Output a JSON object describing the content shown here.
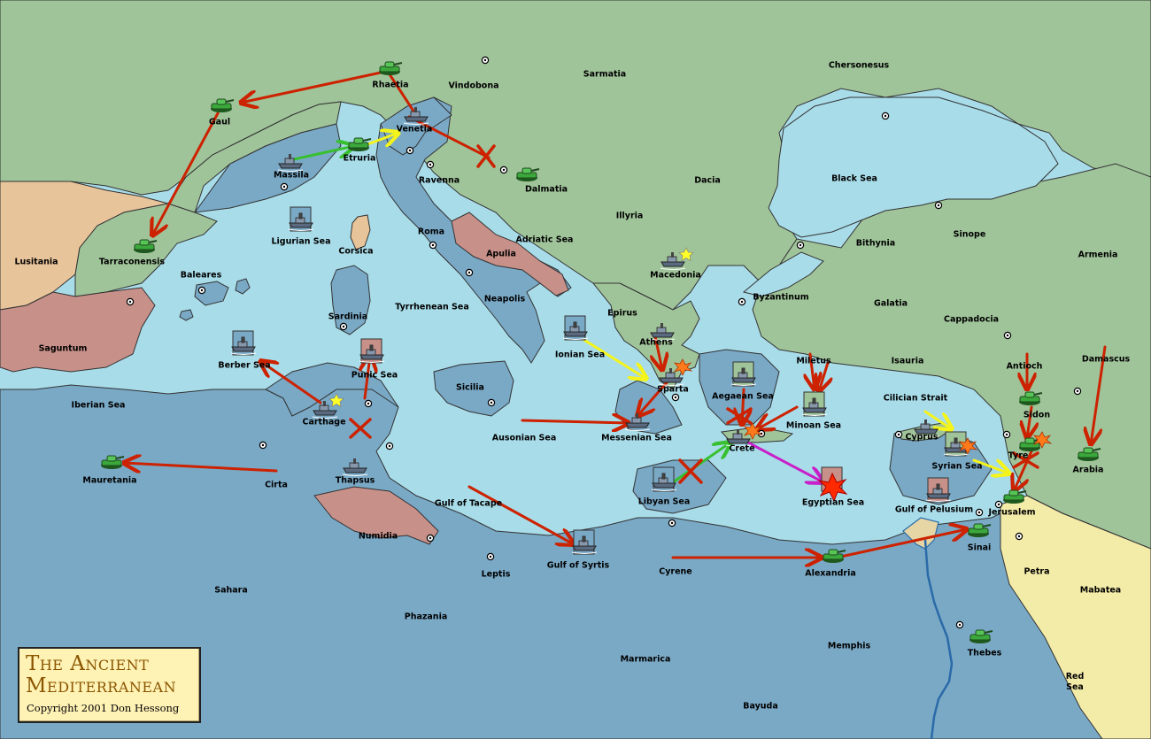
{
  "title": {
    "line1": "The Ancient",
    "line2": "Mediterranean",
    "copyright": "Copyright  2001  Don Hessong"
  },
  "colors": {
    "deep_sea": "#a8dce9",
    "sea_zone": "#7aa9c6",
    "land_green": "#a0c49a",
    "land_tan": "#e8c49a",
    "land_rose": "#c79089",
    "land_cream": "#f3eba8",
    "order_red": "#cc2200",
    "order_yellow": "#f4f41a",
    "order_green": "#38c030",
    "order_magenta": "#c820c8"
  },
  "territories": [
    {
      "name": "Sarmatia"
    },
    {
      "name": "Chersonesus"
    },
    {
      "name": "Vindobona"
    },
    {
      "name": "Rhaetia"
    },
    {
      "name": "Gaul"
    },
    {
      "name": "Venetia"
    },
    {
      "name": "Etruria"
    },
    {
      "name": "Massila"
    },
    {
      "name": "Ravenna"
    },
    {
      "name": "Dalmatia"
    },
    {
      "name": "Dacia"
    },
    {
      "name": "Black Sea"
    },
    {
      "name": "Illyria"
    },
    {
      "name": "Roma"
    },
    {
      "name": "Ligurian Sea"
    },
    {
      "name": "Adriatic Sea"
    },
    {
      "name": "Corsica"
    },
    {
      "name": "Apulia"
    },
    {
      "name": "Bithynia"
    },
    {
      "name": "Sinope"
    },
    {
      "name": "Armenia"
    },
    {
      "name": "Lusitania"
    },
    {
      "name": "Tarraconensis"
    },
    {
      "name": "Baleares"
    },
    {
      "name": "Macedonia"
    },
    {
      "name": "Byzantinum"
    },
    {
      "name": "Sardinia"
    },
    {
      "name": "Tyrrhenean Sea"
    },
    {
      "name": "Neapolis"
    },
    {
      "name": "Galatia"
    },
    {
      "name": "Cappadocia"
    },
    {
      "name": "Epirus"
    },
    {
      "name": "Saguntum"
    },
    {
      "name": "Athens"
    },
    {
      "name": "Ionian Sea"
    },
    {
      "name": "Miletus"
    },
    {
      "name": "Isauria"
    },
    {
      "name": "Antioch"
    },
    {
      "name": "Damascus"
    },
    {
      "name": "Berber Sea"
    },
    {
      "name": "Punic Sea"
    },
    {
      "name": "Sparta"
    },
    {
      "name": "Sicilia"
    },
    {
      "name": "Aegaean Sea"
    },
    {
      "name": "Cilician Strait"
    },
    {
      "name": "Sidon"
    },
    {
      "name": "Iberian Sea"
    },
    {
      "name": "Carthage"
    },
    {
      "name": "Minoan Sea"
    },
    {
      "name": "Ausonian Sea"
    },
    {
      "name": "Messenian Sea"
    },
    {
      "name": "Cyprus"
    },
    {
      "name": "Crete"
    },
    {
      "name": "Tyre"
    },
    {
      "name": "Syrian Sea"
    },
    {
      "name": "Arabia"
    },
    {
      "name": "Mauretania"
    },
    {
      "name": "Cirta"
    },
    {
      "name": "Thapsus"
    },
    {
      "name": "Libyan Sea"
    },
    {
      "name": "Egyptian Sea"
    },
    {
      "name": "Gulf of Tacape"
    },
    {
      "name": "Jerusalem"
    },
    {
      "name": "Gulf of Pelusium"
    },
    {
      "name": "Numidia"
    },
    {
      "name": "Sinai"
    },
    {
      "name": "Gulf of Syrtis"
    },
    {
      "name": "Leptis"
    },
    {
      "name": "Cyrene"
    },
    {
      "name": "Alexandria"
    },
    {
      "name": "Petra"
    },
    {
      "name": "Sahara"
    },
    {
      "name": "Mabatea"
    },
    {
      "name": "Phazania"
    },
    {
      "name": "Memphis"
    },
    {
      "name": "Thebes"
    },
    {
      "name": "Marmarica"
    },
    {
      "name": "Red Sea"
    },
    {
      "name": "Bayuda"
    }
  ]
}
